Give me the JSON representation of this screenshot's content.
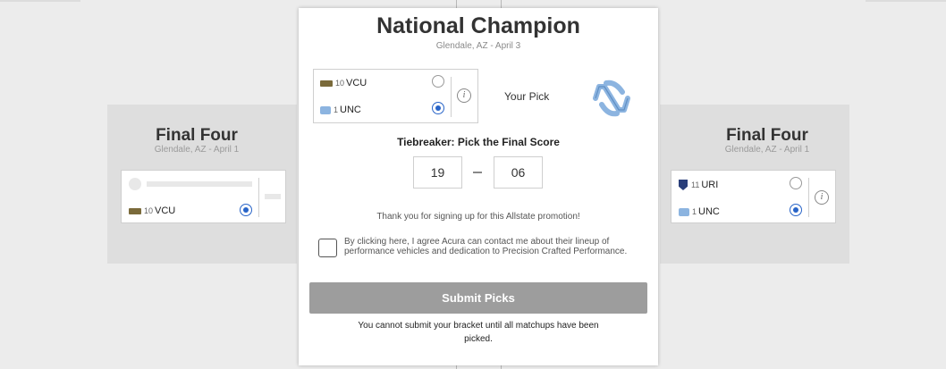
{
  "left_panel": {
    "title": "Final Four",
    "subtitle": "Glendale, AZ - April 1",
    "matchup": {
      "top": {
        "placeholder": true
      },
      "bottom": {
        "seed": "10",
        "name": "VCU",
        "selected": true
      }
    }
  },
  "right_panel": {
    "title": "Final Four",
    "subtitle": "Glendale, AZ - April 1",
    "matchup": {
      "top": {
        "seed": "11",
        "name": "URI",
        "selected": false
      },
      "bottom": {
        "seed": "1",
        "name": "UNC",
        "selected": true
      }
    }
  },
  "modal": {
    "title": "National Champion",
    "subtitle": "Glendale, AZ  -  April 3",
    "matchup": {
      "top": {
        "seed": "10",
        "name": "VCU",
        "selected": false
      },
      "bottom": {
        "seed": "1",
        "name": "UNC",
        "selected": true
      }
    },
    "pick_label": "Your Pick",
    "tiebreaker_label": "Tiebreaker: Pick the Final Score",
    "score_left": "19",
    "score_right": "06",
    "thanks_text": "Thank you for signing up for this Allstate promotion!",
    "consent_text": "By clicking here, I agree Acura can contact me about their lineup of performance vehicles and dedication to Precision Crafted Performance.",
    "submit_label": "Submit Picks",
    "warning_text": "You cannot submit your bracket until all matchups have been picked."
  },
  "colors": {
    "selected_radio": "#2864c8",
    "unc_blue": "#8cb4e0",
    "submit_disabled": "#9d9d9d"
  },
  "icons": [
    "info-icon",
    "unc-logo",
    "vcu-logo",
    "uri-logo",
    "radio-button",
    "checkbox"
  ]
}
